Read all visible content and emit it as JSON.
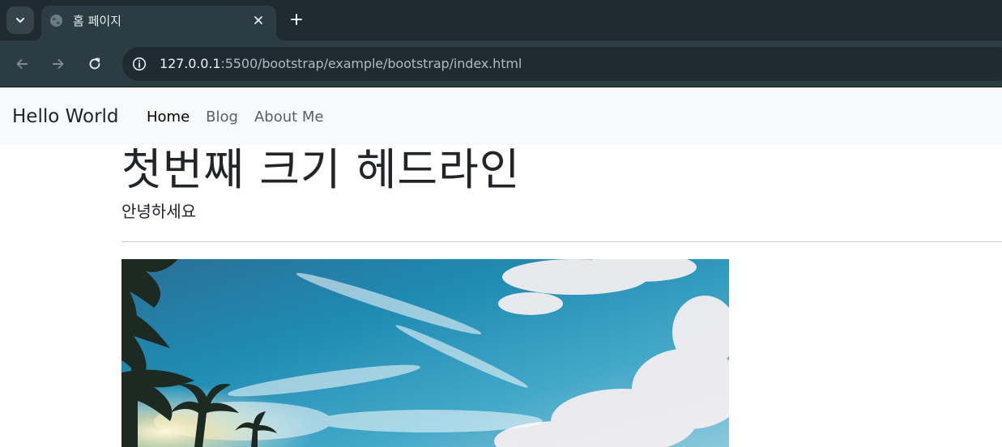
{
  "browser": {
    "tab": {
      "title": "홈 페이지",
      "favicon": "globe-icon"
    },
    "address": {
      "host": "127.0.0.1",
      "rest": ":5500/bootstrap/example/bootstrap/index.html"
    },
    "icons": {
      "tab_search": "chevron-down-icon",
      "close": "close-icon",
      "new_tab": "plus-icon",
      "back": "arrow-left-icon",
      "forward": "arrow-right-icon",
      "reload": "reload-icon",
      "site_info": "info-icon"
    }
  },
  "navbar": {
    "brand": "Hello World",
    "links": [
      {
        "label": "Home",
        "active": true
      },
      {
        "label": "Blog",
        "active": false
      },
      {
        "label": "About Me",
        "active": false
      }
    ]
  },
  "content": {
    "headline": "첫번째 크기 헤드라인",
    "lead": "안녕하세요",
    "image": "beach-sky-palms-photo"
  },
  "colors": {
    "chrome_dark": "#1f2b30",
    "chrome_toolbar": "#2b3c42",
    "navbar_bg": "#f8f9fa",
    "text": "#212529"
  }
}
